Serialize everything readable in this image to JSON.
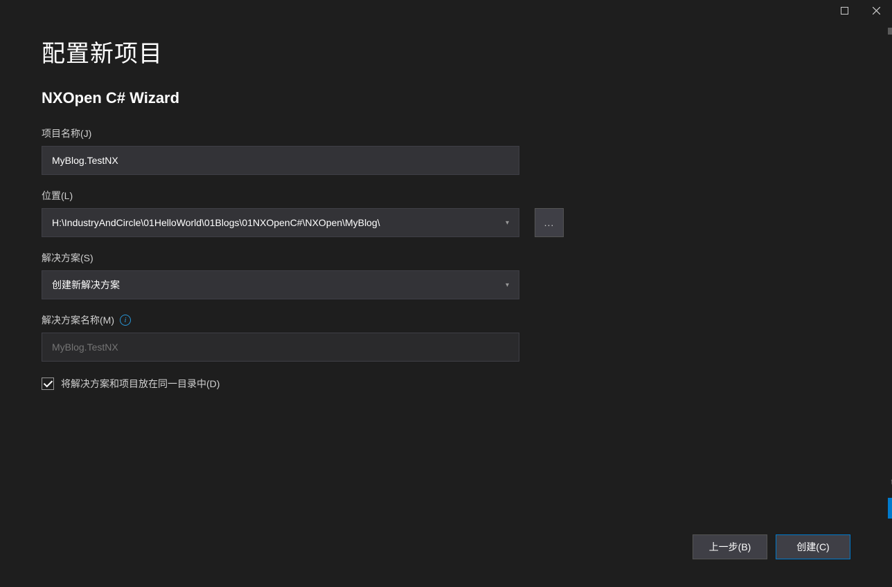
{
  "titlebar": {
    "maximize": "maximize",
    "close": "close"
  },
  "page": {
    "title": "配置新项目",
    "subtitle": "NXOpen C# Wizard"
  },
  "fields": {
    "projectName": {
      "label": "项目名称(J)",
      "value": "MyBlog.TestNX"
    },
    "location": {
      "label": "位置(L)",
      "value": "H:\\IndustryAndCircle\\01HelloWorld\\01Blogs\\01NXOpenC#\\NXOpen\\MyBlog\\",
      "browse": "..."
    },
    "solution": {
      "label": "解决方案(S)",
      "value": "创建新解决方案"
    },
    "solutionName": {
      "label": "解决方案名称(M)",
      "value": "",
      "placeholder": "MyBlog.TestNX"
    },
    "sameDir": {
      "label": "将解决方案和项目放在同一目录中(D)",
      "checked": true
    }
  },
  "footer": {
    "back": "上一步(B)",
    "create": "创建(C)"
  }
}
